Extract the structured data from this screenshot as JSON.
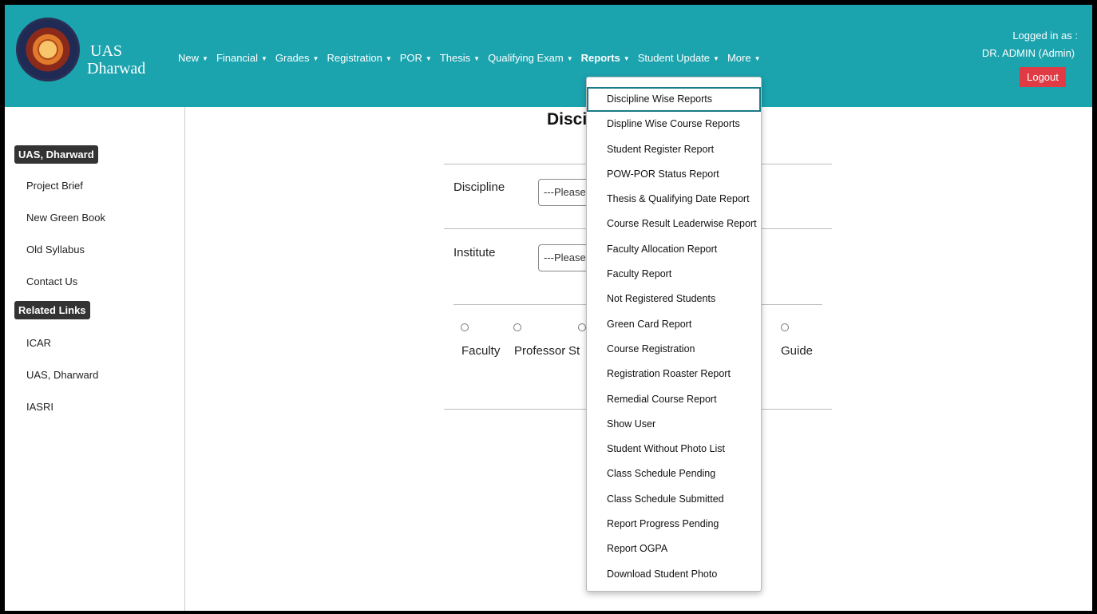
{
  "brand": {
    "line1": "UAS",
    "line2": "Dharwad"
  },
  "nav": [
    {
      "label": "New",
      "active": false
    },
    {
      "label": "Financial",
      "active": false
    },
    {
      "label": "Grades",
      "active": false
    },
    {
      "label": "Registration",
      "active": false
    },
    {
      "label": "POR",
      "active": false
    },
    {
      "label": "Thesis",
      "active": false
    },
    {
      "label": "Qualifying Exam",
      "active": false
    },
    {
      "label": "Reports",
      "active": true
    },
    {
      "label": "Student Update",
      "active": false
    },
    {
      "label": "More",
      "active": false
    }
  ],
  "login": {
    "line1": "Logged in as :",
    "line2": "DR. ADMIN (Admin)",
    "logout": "Logout"
  },
  "sidebar": {
    "head1": "UAS, Dharward",
    "links1": [
      "Project Brief",
      "New Green Book",
      "Old Syllabus",
      "Contact Us"
    ],
    "head2": "Related Links",
    "links2": [
      "ICAR",
      "UAS, Dharward",
      "IASRI"
    ]
  },
  "main": {
    "title": "Discip",
    "discipline_label": "Discipline",
    "discipline_value": "---Please",
    "institute_label": "Institute",
    "institute_value": "---Please",
    "radios": [
      "Faculty",
      "Professor",
      "St",
      "Guide"
    ]
  },
  "dropdown": [
    "Discipline Wise Reports",
    "Displine Wise Course Reports",
    "Student Register Report",
    "POW-POR Status Report",
    "Thesis & Qualifying Date Report",
    "Course Result Leaderwise Report",
    "Faculty Allocation Report",
    "Faculty Report",
    "Not Registered Students",
    "Green Card Report",
    "Course Registration",
    "Registration Roaster Report",
    "Remedial Course Report",
    "Show User",
    "Student Without Photo List",
    "Class Schedule Pending",
    "Class Schedule Submitted",
    "Report Progress Pending",
    "Report OGPA",
    "Download Student Photo"
  ],
  "colors": {
    "header": "#1ba3ae",
    "logout": "#e03a45",
    "sidebar_head": "#333333"
  }
}
